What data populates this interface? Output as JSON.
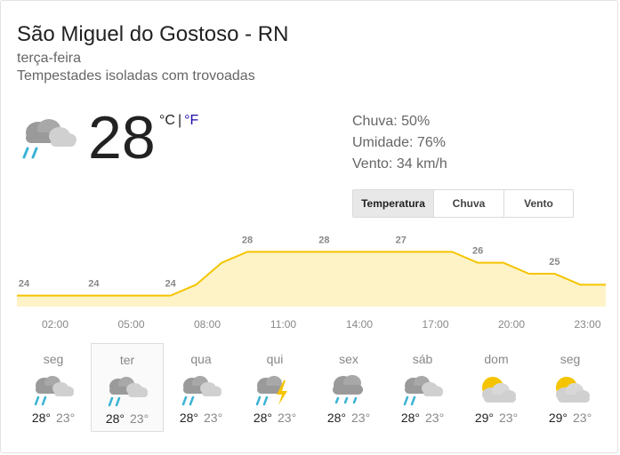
{
  "header": {
    "location": "São Miguel do Gostoso - RN",
    "day": "terça-feira",
    "condition": "Tempestades isoladas com trovoadas"
  },
  "current": {
    "temperature": "28",
    "unit_c": "°C",
    "unit_sep": "|",
    "unit_f": "°F",
    "icon": "rain-cloud-icon"
  },
  "details": {
    "rain": "Chuva: 50%",
    "humidity": "Umidade: 76%",
    "wind": "Vento: 34 km/h"
  },
  "tabs": [
    {
      "label": "Temperatura",
      "active": true
    },
    {
      "label": "Chuva",
      "active": false
    },
    {
      "label": "Vento",
      "active": false
    }
  ],
  "colors": {
    "line": "#f5c400",
    "fill": "#fdf3c7",
    "link": "#1a0dab"
  },
  "chart_data": {
    "type": "area",
    "x_labels": [
      "02:00",
      "05:00",
      "08:00",
      "11:00",
      "14:00",
      "17:00",
      "20:00",
      "23:00"
    ],
    "values": [
      24,
      24,
      24,
      24,
      24,
      24,
      24,
      25,
      27,
      28,
      28,
      28,
      28,
      28,
      28,
      28,
      28,
      28,
      27,
      27,
      26,
      26,
      25,
      25
    ],
    "point_labels": [
      {
        "index": 0,
        "text": "24"
      },
      {
        "index": 3,
        "text": "24"
      },
      {
        "index": 6,
        "text": "24"
      },
      {
        "index": 9,
        "text": "28"
      },
      {
        "index": 12,
        "text": "28"
      },
      {
        "index": 15,
        "text": "27"
      },
      {
        "index": 18,
        "text": "26"
      },
      {
        "index": 21,
        "text": "25"
      }
    ],
    "ylim": [
      23,
      29
    ]
  },
  "forecast": [
    {
      "day": "seg",
      "hi": "28°",
      "lo": "23°",
      "icon": "rain-cloud-icon",
      "selected": false
    },
    {
      "day": "ter",
      "hi": "28°",
      "lo": "23°",
      "icon": "rain-cloud-icon",
      "selected": true
    },
    {
      "day": "qua",
      "hi": "28°",
      "lo": "23°",
      "icon": "rain-cloud-icon",
      "selected": false
    },
    {
      "day": "qui",
      "hi": "28°",
      "lo": "23°",
      "icon": "thunderstorm-icon",
      "selected": false
    },
    {
      "day": "sex",
      "hi": "28°",
      "lo": "23°",
      "icon": "showers-icon",
      "selected": false
    },
    {
      "day": "sáb",
      "hi": "28°",
      "lo": "23°",
      "icon": "rain-cloud-icon",
      "selected": false
    },
    {
      "day": "dom",
      "hi": "29°",
      "lo": "23°",
      "icon": "partly-sunny-icon",
      "selected": false
    },
    {
      "day": "seg",
      "hi": "29°",
      "lo": "23°",
      "icon": "partly-sunny-icon",
      "selected": false
    }
  ]
}
